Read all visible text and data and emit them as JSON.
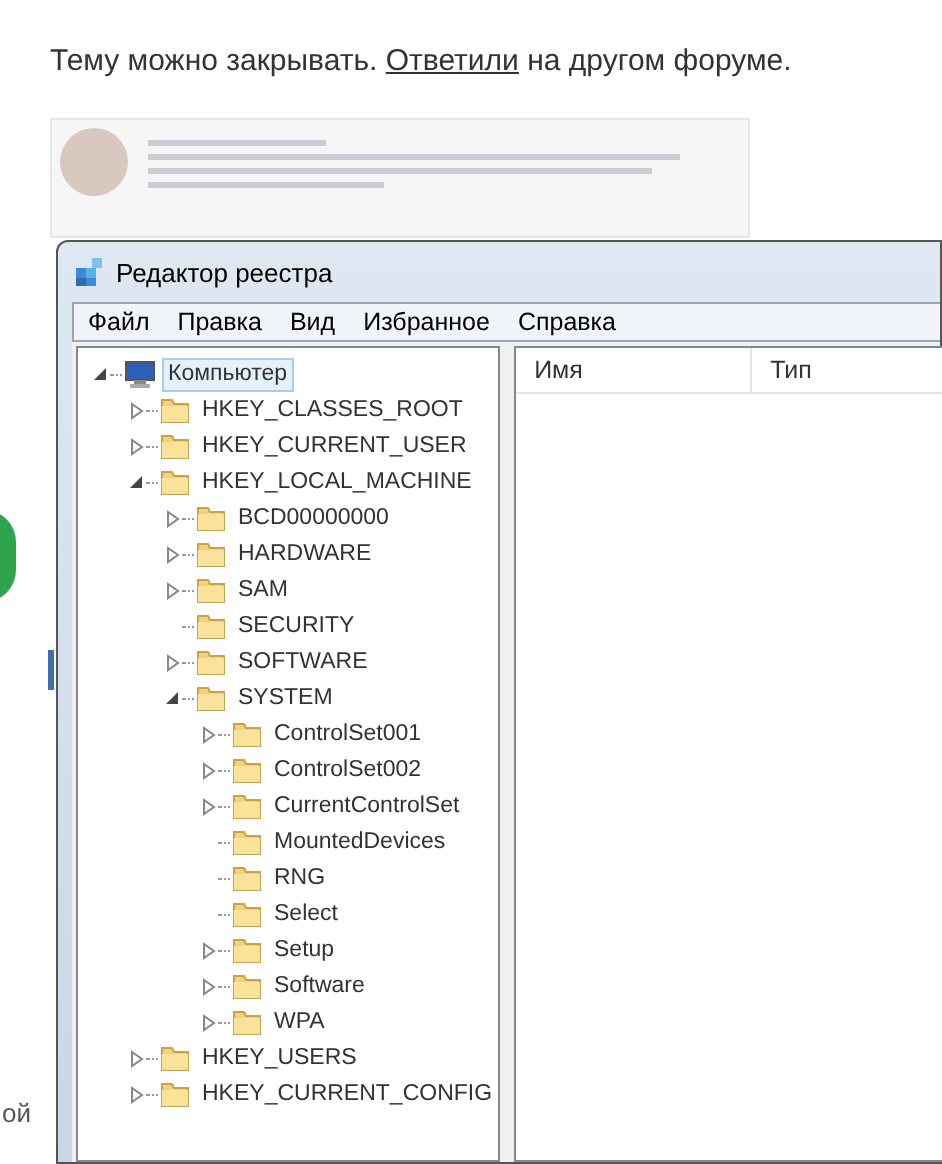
{
  "post": {
    "before": "Тему можно закрывать. ",
    "link": "Ответили",
    "after": " на другом форуме."
  },
  "background_fragments": [
    "ой"
  ],
  "window": {
    "title": "Редактор реестра"
  },
  "menu": [
    "Файл",
    "Правка",
    "Вид",
    "Избранное",
    "Справка"
  ],
  "tree": [
    {
      "label": "Компьютер",
      "expandable": true,
      "expanded": true,
      "selected": true,
      "children": [
        {
          "label": "HKEY_CLASSES_ROOT",
          "expandable": true,
          "expanded": false,
          "selected": false
        },
        {
          "label": "HKEY_CURRENT_USER",
          "expandable": true,
          "expanded": false,
          "selected": false
        },
        {
          "label": "HKEY_LOCAL_MACHINE",
          "expandable": true,
          "expanded": true,
          "selected": false,
          "children": [
            {
              "label": "BCD00000000",
              "expandable": true,
              "expanded": false,
              "selected": false
            },
            {
              "label": "HARDWARE",
              "expandable": true,
              "expanded": false,
              "selected": false
            },
            {
              "label": "SAM",
              "expandable": true,
              "expanded": false,
              "selected": false
            },
            {
              "label": "SECURITY",
              "expandable": false,
              "selected": false
            },
            {
              "label": "SOFTWARE",
              "expandable": true,
              "expanded": false,
              "selected": false
            },
            {
              "label": "SYSTEM",
              "expandable": true,
              "expanded": true,
              "selected": false,
              "children": [
                {
                  "label": "ControlSet001",
                  "expandable": true,
                  "expanded": false,
                  "selected": false
                },
                {
                  "label": "ControlSet002",
                  "expandable": true,
                  "expanded": false,
                  "selected": false
                },
                {
                  "label": "CurrentControlSet",
                  "expandable": true,
                  "expanded": false,
                  "selected": false
                },
                {
                  "label": "MountedDevices",
                  "expandable": false,
                  "selected": false
                },
                {
                  "label": "RNG",
                  "expandable": false,
                  "selected": false
                },
                {
                  "label": "Select",
                  "expandable": false,
                  "selected": false
                },
                {
                  "label": "Setup",
                  "expandable": true,
                  "expanded": false,
                  "selected": false
                },
                {
                  "label": "Software",
                  "expandable": true,
                  "expanded": false,
                  "selected": false
                },
                {
                  "label": "WPA",
                  "expandable": true,
                  "expanded": false,
                  "selected": false
                }
              ]
            }
          ]
        },
        {
          "label": "HKEY_USERS",
          "expandable": true,
          "expanded": false,
          "selected": false
        },
        {
          "label": "HKEY_CURRENT_CONFIG",
          "expandable": true,
          "expanded": false,
          "selected": false
        }
      ]
    }
  ],
  "columns": [
    "Имя",
    "Тип"
  ]
}
